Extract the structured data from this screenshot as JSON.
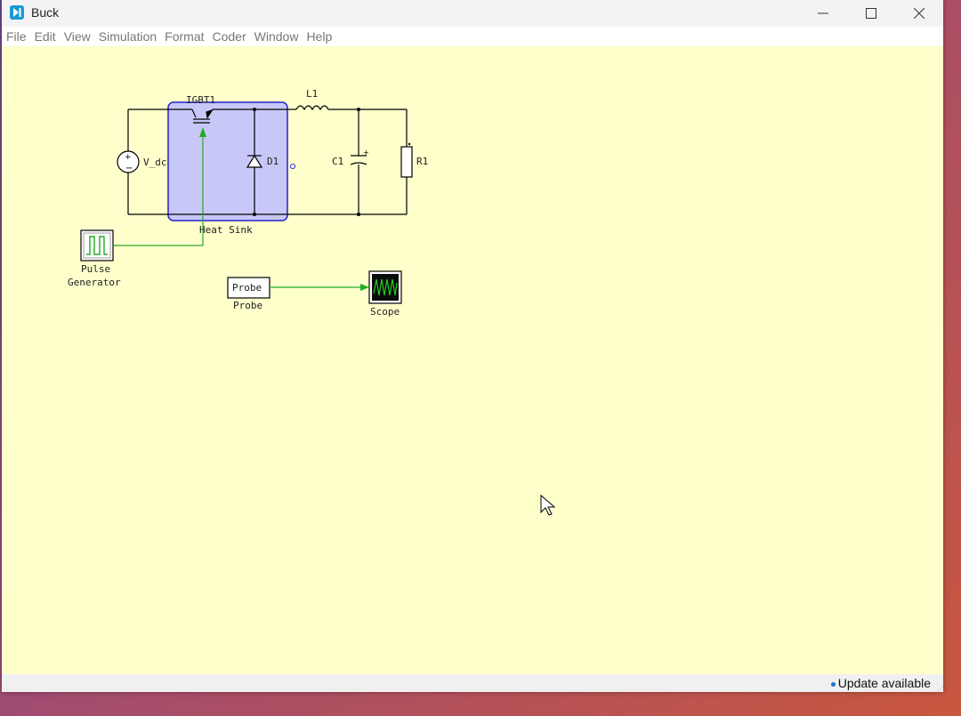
{
  "window": {
    "title": "Buck"
  },
  "menu": [
    "File",
    "Edit",
    "View",
    "Simulation",
    "Format",
    "Coder",
    "Window",
    "Help"
  ],
  "schematic": {
    "components": {
      "igbt": "IGBT1",
      "diode": "D1",
      "inductor": "L1",
      "capacitor": "C1",
      "resistor": "R1",
      "source": "V_dc",
      "heatsink": "Heat Sink",
      "pulse_line1": "Pulse",
      "pulse_line2": "Generator",
      "probe_block": "Probe",
      "probe_label": "Probe",
      "scope": "Scope"
    },
    "colors": {
      "wire": "#000000",
      "signal_wire": "#22aa22",
      "heatsink_fill": "#c8c8f8",
      "heatsink_border": "#2222cc",
      "canvas": "#ffffcc"
    }
  },
  "status": {
    "update_text": "Update available",
    "update_dot_color": "#1b6fd1"
  }
}
